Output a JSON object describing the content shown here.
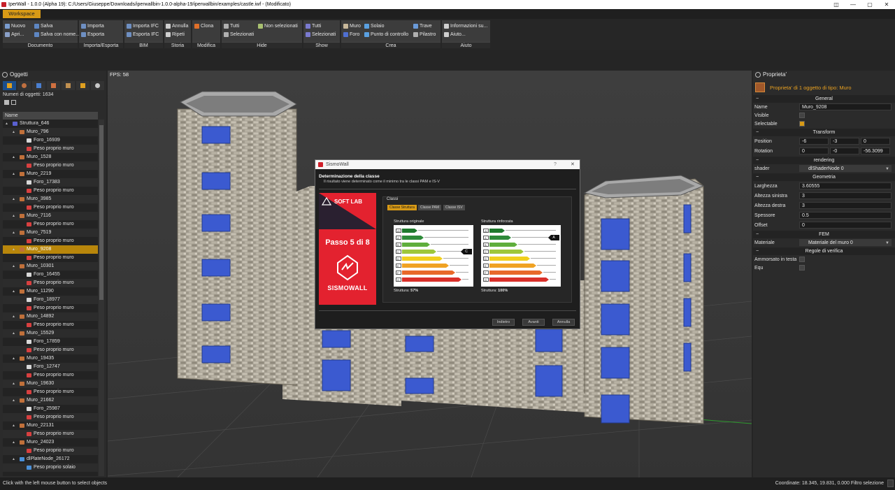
{
  "window": {
    "title": "IperWall - 1.0.0 (Alpha 19): C:/Users/Giuseppe/Downloads/iperwallbin-1.0.0-alpha-19/iperwallbin/examples/castle.iwf  - (Modificato)",
    "min": "—",
    "max": "▢",
    "close": "✕",
    "layout": "◫"
  },
  "menubar": {
    "workspace": "Workspace"
  },
  "ribbon": {
    "documento": {
      "label": "Documento",
      "nuovo": "Nuovo",
      "apri": "Apri...",
      "salva": "Salva",
      "salva_nome": "Salva con nome..."
    },
    "importa_esporta": {
      "label": "Importa/Esporta",
      "importa": "Importa",
      "esporta": "Esporta"
    },
    "bim": {
      "label": "BIM",
      "importa_ifc": "Importa IFC",
      "esporta_ifc": "Esporta IFC"
    },
    "storia": {
      "label": "Storia",
      "annulla": "Annulla",
      "ripeti": "Ripeti"
    },
    "modifica": {
      "label": "Modifica",
      "clona": "Clona"
    },
    "hide": {
      "label": "Hide",
      "tutti": "Tutti",
      "selezionati": "Selezionati",
      "non_selezionati": "Non selezionati"
    },
    "show": {
      "label": "Show",
      "tutti": "Tutti",
      "selezionati": "Selezionati"
    },
    "crea": {
      "label": "Crea",
      "muro": "Muro",
      "foro": "Foro",
      "solaio": "Solaio",
      "punto_controllo": "Punto di controllo",
      "trave": "Trave",
      "pilastro": "Pilastro"
    },
    "aiuto": {
      "label": "Aiuto",
      "info": "Informazioni su...",
      "aiuto": "Aiuto..."
    }
  },
  "objects_panel": {
    "title": "Oggetti",
    "count": "Numeri di oggetti: 1634",
    "col_name": "Name",
    "rows": [
      {
        "t": "Struttura_646",
        "lvl": 0,
        "k": "root"
      },
      {
        "t": "Muro_796",
        "lvl": 1,
        "k": "muro"
      },
      {
        "t": "Foro_16939",
        "lvl": 2,
        "k": "foro"
      },
      {
        "t": "Peso proprio muro",
        "lvl": 2,
        "k": "peso"
      },
      {
        "t": "Muro_1528",
        "lvl": 1,
        "k": "muro"
      },
      {
        "t": "Peso proprio muro",
        "lvl": 2,
        "k": "peso"
      },
      {
        "t": "Muro_2219",
        "lvl": 1,
        "k": "muro"
      },
      {
        "t": "Foro_17383",
        "lvl": 2,
        "k": "foro"
      },
      {
        "t": "Peso proprio muro",
        "lvl": 2,
        "k": "peso"
      },
      {
        "t": "Muro_3985",
        "lvl": 1,
        "k": "muro"
      },
      {
        "t": "Peso proprio muro",
        "lvl": 2,
        "k": "peso"
      },
      {
        "t": "Muro_7116",
        "lvl": 1,
        "k": "muro"
      },
      {
        "t": "Peso proprio muro",
        "lvl": 2,
        "k": "peso"
      },
      {
        "t": "Muro_7519",
        "lvl": 1,
        "k": "muro"
      },
      {
        "t": "Peso proprio muro",
        "lvl": 2,
        "k": "peso"
      },
      {
        "t": "Muro_9208",
        "lvl": 1,
        "k": "muro",
        "sel": true
      },
      {
        "t": "Peso proprio muro",
        "lvl": 2,
        "k": "peso"
      },
      {
        "t": "Muro_10301",
        "lvl": 1,
        "k": "muro"
      },
      {
        "t": "Foro_16455",
        "lvl": 2,
        "k": "foro"
      },
      {
        "t": "Peso proprio muro",
        "lvl": 2,
        "k": "peso"
      },
      {
        "t": "Muro_11290",
        "lvl": 1,
        "k": "muro"
      },
      {
        "t": "Foro_18977",
        "lvl": 2,
        "k": "foro"
      },
      {
        "t": "Peso proprio muro",
        "lvl": 2,
        "k": "peso"
      },
      {
        "t": "Muro_14892",
        "lvl": 1,
        "k": "muro"
      },
      {
        "t": "Peso proprio muro",
        "lvl": 2,
        "k": "peso"
      },
      {
        "t": "Muro_15529",
        "lvl": 1,
        "k": "muro"
      },
      {
        "t": "Foro_17859",
        "lvl": 2,
        "k": "foro"
      },
      {
        "t": "Peso proprio muro",
        "lvl": 2,
        "k": "peso"
      },
      {
        "t": "Muro_19435",
        "lvl": 1,
        "k": "muro"
      },
      {
        "t": "Foro_12747",
        "lvl": 2,
        "k": "foro"
      },
      {
        "t": "Peso proprio muro",
        "lvl": 2,
        "k": "peso"
      },
      {
        "t": "Muro_19630",
        "lvl": 1,
        "k": "muro"
      },
      {
        "t": "Peso proprio muro",
        "lvl": 2,
        "k": "peso"
      },
      {
        "t": "Muro_21662",
        "lvl": 1,
        "k": "muro"
      },
      {
        "t": "Foro_25987",
        "lvl": 2,
        "k": "foro"
      },
      {
        "t": "Peso proprio muro",
        "lvl": 2,
        "k": "peso"
      },
      {
        "t": "Muro_22131",
        "lvl": 1,
        "k": "muro"
      },
      {
        "t": "Peso proprio muro",
        "lvl": 2,
        "k": "peso"
      },
      {
        "t": "Muro_24023",
        "lvl": 1,
        "k": "muro"
      },
      {
        "t": "Peso proprio muro",
        "lvl": 2,
        "k": "peso"
      },
      {
        "t": "dlPlateNode_26172",
        "lvl": 1,
        "k": "plate"
      },
      {
        "t": "Peso proprio solaio",
        "lvl": 2,
        "k": "pesos"
      }
    ]
  },
  "viewport": {
    "fps": "FPS: 58"
  },
  "properties": {
    "title": "Proprieta'",
    "info": "Proprieta' di 1 oggetto di tipo: Muro",
    "sec_general": "General",
    "name_k": "Name",
    "name_v": "Muro_9208",
    "visible_k": "Visible",
    "selectable_k": "Selectable",
    "sec_transform": "Transform",
    "pos_k": "Position",
    "pos_x": "-6",
    "pos_y": "-3",
    "pos_z": "0",
    "rot_k": "Rotation",
    "rot_x": "0",
    "rot_y": "-0",
    "rot_z": "-56.3099",
    "sec_rendering": "rendering",
    "shader_k": "shader",
    "shader_v": "dlShaderNode 0",
    "sec_geometria": "Geometria",
    "larg_k": "Larghezza",
    "larg_v": "3.60555",
    "alt_sx_k": "Altezza sinistra",
    "alt_sx_v": "3",
    "alt_dx_k": "Altezza destra",
    "alt_dx_v": "3",
    "spess_k": "Spessore",
    "spess_v": "0.5",
    "offset_k": "Offset",
    "offset_v": "0",
    "sec_fem": "FEM",
    "mat_k": "Materiale",
    "mat_v": "Materiale del muro 0",
    "sec_regole": "Regole di verifica",
    "ammors_k": "Ammorsato in testa",
    "equ_k": "Equ"
  },
  "dialog": {
    "title": "SismoWall",
    "help": "?",
    "close": "✕",
    "heading": "Determinazione della classe",
    "sub": "Il risultato viene determinato come il minimo tra le classi PAM e IS-V",
    "softlab": "SOFT LAB",
    "passo": "Passo 5 di 8",
    "brand": "SISMOWALL",
    "classi": "Classi",
    "tab1": "Classe Struttura",
    "tab2": "Classe PAM",
    "tab3": "Classe ISV",
    "card1_title": "Struttura originale",
    "card1_foot": "Struttura:",
    "card1_pct": "57%",
    "card1_class": "C",
    "card2_title": "Struttura rinforzata",
    "card2_foot": "Struttura:",
    "card2_pct": "100%",
    "card2_class": "A",
    "classes": [
      "A+",
      "A",
      "B",
      "C",
      "D",
      "E",
      "F",
      "G"
    ],
    "class_colors": [
      "#1f7a2e",
      "#2e8b3a",
      "#5fae3c",
      "#9ec73a",
      "#f1cf1e",
      "#f0a223",
      "#e8692a",
      "#d9302a"
    ],
    "btn_indietro": "Indietro",
    "btn_avanti": "Avanti",
    "btn_annulla": "Annulla"
  },
  "status": {
    "left": "Click with the left mouse button to select objects",
    "right": "Coordinate: 18.345, 19.831, 0.000  Filtro selezione"
  }
}
